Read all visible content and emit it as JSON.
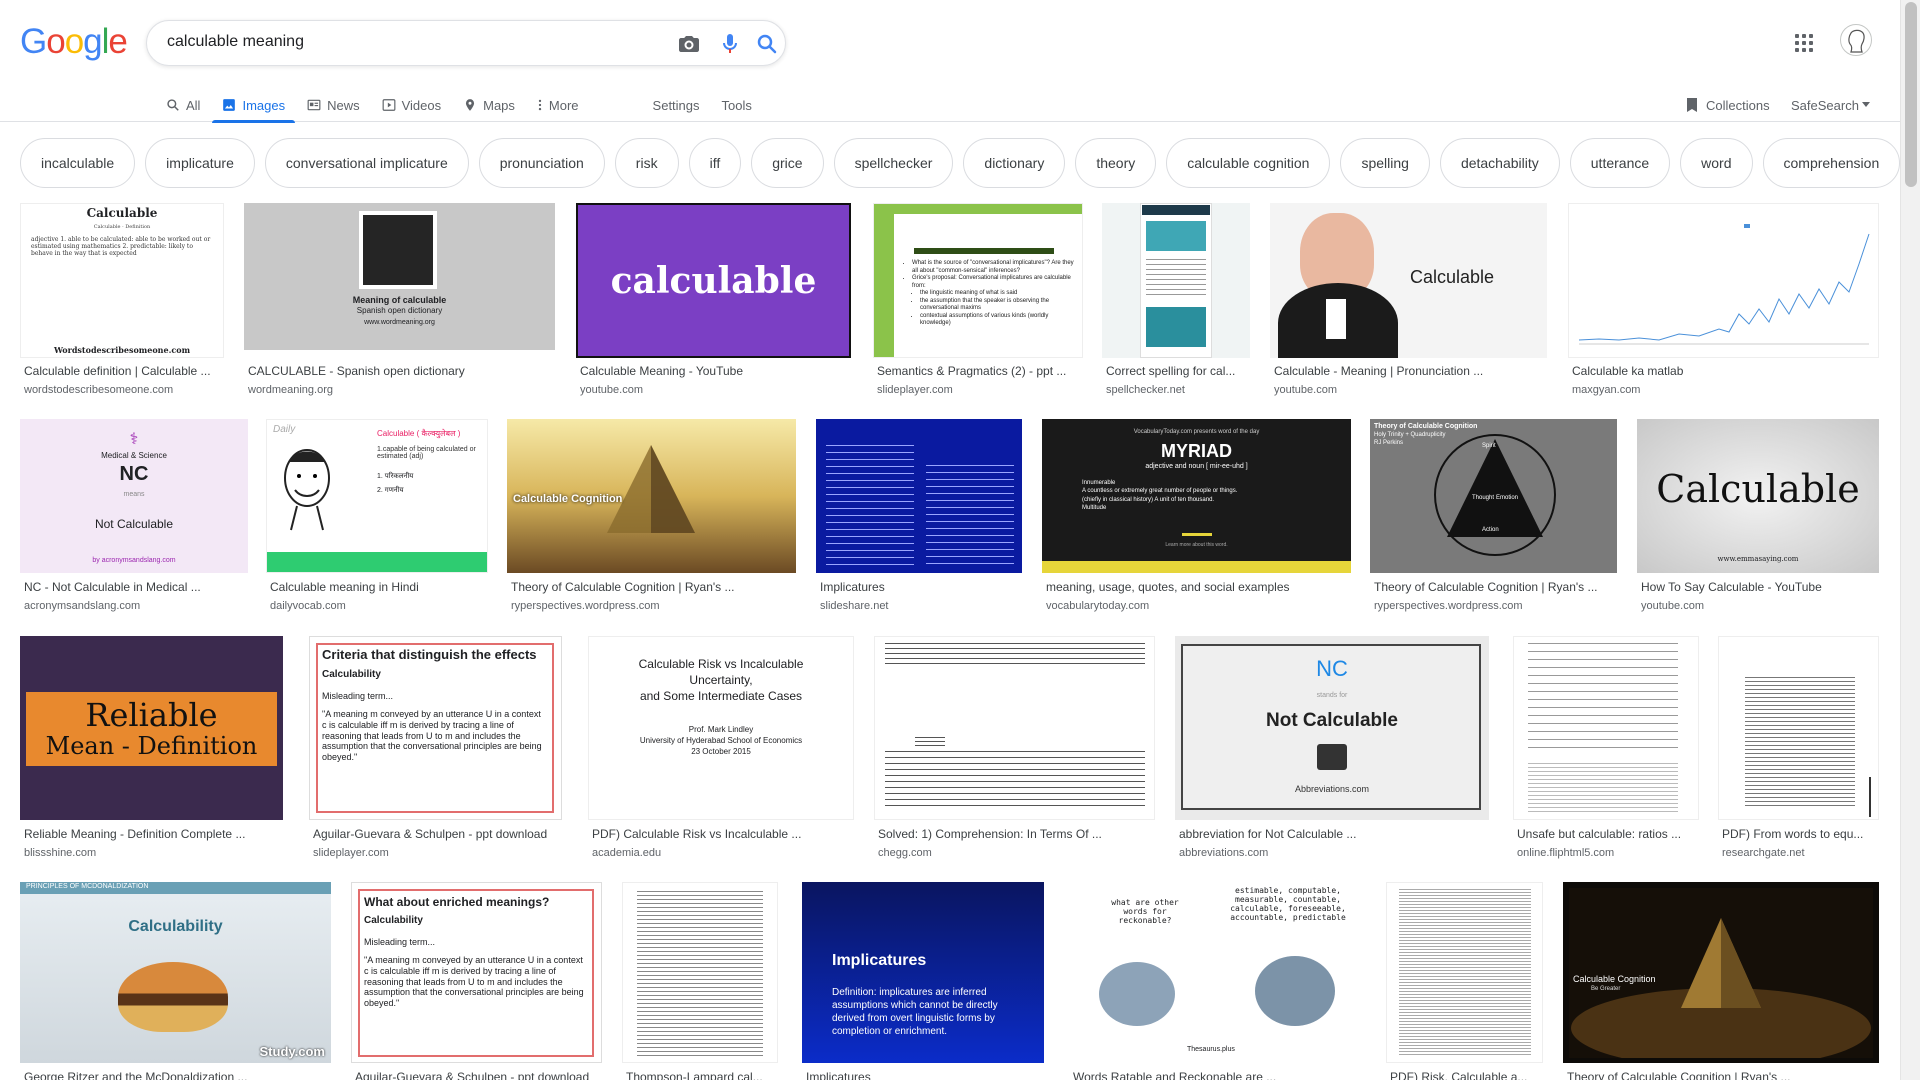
{
  "logo": {
    "letters": [
      "G",
      "o",
      "o",
      "g",
      "l",
      "e"
    ],
    "colors": [
      "#4285f4",
      "#ea4335",
      "#fbbc05",
      "#4285f4",
      "#34a853",
      "#ea4335"
    ]
  },
  "search": {
    "query": "calculable meaning",
    "camera_icon": "camera-icon",
    "mic_icon": "microphone-icon",
    "search_icon": "search-icon"
  },
  "tabs": [
    "All",
    "Images",
    "News",
    "Videos",
    "Maps",
    "More"
  ],
  "tools": [
    "Settings",
    "Tools"
  ],
  "right": {
    "collections": "Collections",
    "safesearch": "SafeSearch"
  },
  "chips": [
    "incalculable",
    "implicature",
    "conversational implicature",
    "pronunciation",
    "risk",
    "iff",
    "grice",
    "spellchecker",
    "dictionary",
    "theory",
    "calculable cognition",
    "spelling",
    "detachability",
    "utterance",
    "word",
    "comprehension"
  ],
  "results": [
    {
      "title": "Calculable definition | Calculable ...",
      "source": "wordstodescribesomeone.com"
    },
    {
      "title": "CALCULABLE - Spanish open dictionary",
      "source": "wordmeaning.org"
    },
    {
      "title": "Calculable Meaning - YouTube",
      "source": "youtube.com"
    },
    {
      "title": "Semantics & Pragmatics (2) - ppt ...",
      "source": "slideplayer.com"
    },
    {
      "title": "Correct spelling for cal...",
      "source": "spellchecker.net"
    },
    {
      "title": "Calculable - Meaning | Pronunciation ...",
      "source": "youtube.com"
    },
    {
      "title": "Calculable ka matlab",
      "source": "maxgyan.com"
    },
    {
      "title": "NC - Not Calculable in Medical ...",
      "source": "acronymsandslang.com"
    },
    {
      "title": "Calculable meaning in Hindi",
      "source": "dailyvocab.com"
    },
    {
      "title": "Theory of Calculable Cognition | Ryan's ...",
      "source": "ryperspectives.wordpress.com"
    },
    {
      "title": "Implicatures",
      "source": "slideshare.net"
    },
    {
      "title": "meaning, usage, quotes, and social examples",
      "source": "vocabularytoday.com"
    },
    {
      "title": "Theory of Calculable Cognition | Ryan's ...",
      "source": "ryperspectives.wordpress.com"
    },
    {
      "title": "How To Say Calculable - YouTube",
      "source": "youtube.com"
    },
    {
      "title": "Reliable Meaning - Definition Complete ...",
      "source": "blissshine.com"
    },
    {
      "title": "Aguilar-Guevara & Schulpen - ppt download",
      "source": "slideplayer.com"
    },
    {
      "title": "PDF) Calculable Risk vs Incalculable ...",
      "source": "academia.edu"
    },
    {
      "title": "Solved: 1) Comprehension: In Terms Of ...",
      "source": "chegg.com"
    },
    {
      "title": "abbreviation for Not Calculable ...",
      "source": "abbreviations.com"
    },
    {
      "title": "Unsafe but calculable: ratios ...",
      "source": "online.fliphtml5.com"
    },
    {
      "title": "PDF) From words to equ...",
      "source": "researchgate.net"
    },
    {
      "title": "George Ritzer and the McDonaldization ...",
      "source": ""
    },
    {
      "title": "Aguilar-Guevara & Schulpen - ppt download",
      "source": ""
    },
    {
      "title": "Thompson-Lampard cal...",
      "source": ""
    },
    {
      "title": "Implicatures",
      "source": ""
    },
    {
      "title": "Words Ratable and Reckonable are ...",
      "source": ""
    },
    {
      "title": "PDF) Risk, Calculable a...",
      "source": ""
    },
    {
      "title": "Theory of Calculable Cognition | Ryan's ...",
      "source": ""
    }
  ],
  "thumbs": {
    "t0": {
      "title": "Calculable",
      "sub": "Calculable · Definition",
      "body": "adjective 1. able to be calculated: able to be worked out or estimated using mathematics 2. predictable: likely to behave in the way that is expected",
      "footer": "Wordstodescribesomeone.com"
    },
    "t1": {
      "line1": "Meaning of calculable",
      "line2": "Spanish open dictionary",
      "line3": "www.wordmeaning.org"
    },
    "t2": {
      "word": "calculable"
    },
    "t3": {
      "bullets": [
        "What is the source of \"conversational implicatures\"? Are they all about \"common-sensical\" inferences?",
        "Grice's proposal: Conversational implicatures are calculable from:",
        "the linguistic meaning of what is said",
        "the assumption that the speaker is observing the conversational maxims",
        "contextual assumptions of various kinds (worldly knowledge)"
      ]
    },
    "t5": {
      "word": "Calculable"
    },
    "t7": {
      "top": "Medical & Science",
      "big": "NC",
      "mid": "means",
      "bottom": "Not Calculable",
      "footer": "by acronymsandslang.com"
    },
    "t8": {
      "brand": "Daily",
      "head": "Calculable ( कैल्क्युलेबल )",
      "l1": "1.capable of being calculated or estimated (adj)",
      "l2": "1. परिकलनीय",
      "l3": "2. गणनीय"
    },
    "t9": {
      "label": "Calculable Cognition"
    },
    "t11": {
      "kicker": "VocabularyToday.com presents word of the day",
      "word": "MYRIAD",
      "sub": "adjective and noun [ mir-ee-uhd ]",
      "b1": "Innumerable",
      "b2": "A countless or extremely great number of people or things.",
      "b3": "(chiefly in classical history) A unit of ten thousand.",
      "b4": "Multitude",
      "foot": "Learn more about this word."
    },
    "t12": {
      "t1": "Theory of Calculable Cognition",
      "t2": "Holy Trinity + Quadruplicity",
      "t3": "RJ Perkins",
      "top": "Spirit",
      "left": "Thought",
      "right": "Emotion",
      "bottom": "Action"
    },
    "t13": {
      "word": "Calculable",
      "url": "www.emmasaying.com"
    },
    "t14": {
      "l1": "Reliable",
      "l2": "Mean - Definition"
    },
    "t15": {
      "head": "Criteria that distinguish the effects",
      "sub": "Calculability",
      "mis": "Misleading term...",
      "quote": "\"A meaning m conveyed by an utterance U in a context c is calculable iff m is derived by tracing a line of reasoning that leads from U to m and includes the assumption that the conversational principles are being obeyed.\""
    },
    "t16": {
      "l1": "Calculable Risk vs Incalculable",
      "l2": "Uncertainty,",
      "l3": "and Some Intermediate Cases",
      "l4": "Prof. Mark Lindley",
      "l5": "University of Hyderabad School of Economics",
      "l6": "23 October 2015"
    },
    "t18": {
      "nc": "NC",
      "stands": "stands for",
      "big": "Not Calculable",
      "abbr": "Abbreviations.com"
    },
    "t21": {
      "banner": "PRINCIPLES OF MCDONALDIZATION",
      "word": "Calculability",
      "brand": "Study.com"
    },
    "t22": {
      "head": "What about enriched meanings?",
      "sub": "Calculability",
      "mis": "Misleading term...",
      "quote": "\"A meaning m conveyed by an utterance U in a context c is calculable iff m is derived by tracing a line of reasoning that leads from U to m and includes the assumption that the conversational principles are being obeyed.\""
    },
    "t24": {
      "head": "Implicatures",
      "def": "Definition: implicatures are inferred assumptions which cannot be directly derived from overt linguistic forms by completion or enrichment."
    },
    "t25": {
      "q": "what are other words for reckonable?",
      "a": "estimable, computable, measurable, countable, calculable, foreseeable, accountable, predictable",
      "brand": "Thesaurus.plus"
    },
    "t27": {
      "label": "Calculable Cognition",
      "sub": "Be Greater"
    }
  }
}
